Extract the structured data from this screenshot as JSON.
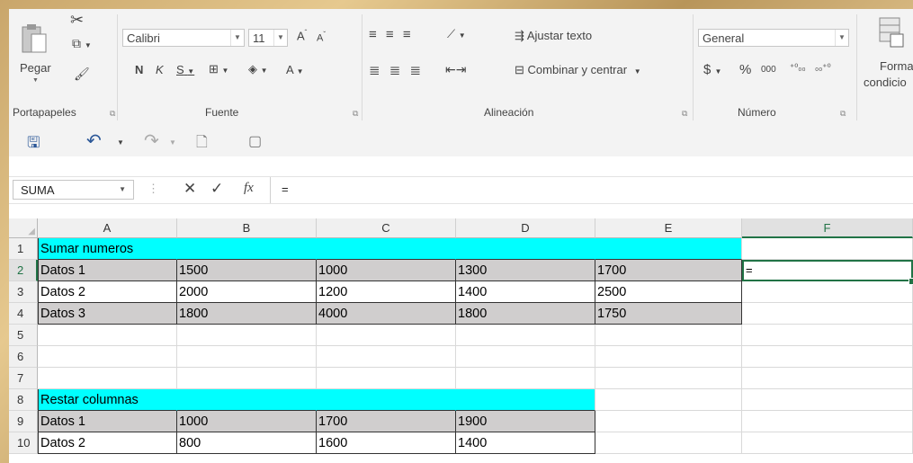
{
  "ribbon": {
    "clipboard": {
      "paste_label": "Pegar",
      "group_label": "Portapapeles"
    },
    "font": {
      "name": "Calibri",
      "size": "11",
      "bold": "N",
      "italic": "K",
      "underline": "S",
      "group_label": "Fuente",
      "grow": "A",
      "shrink": "A",
      "color": "A"
    },
    "alignment": {
      "wrap_label": "Ajustar texto",
      "merge_label": "Combinar y centrar",
      "group_label": "Alineación"
    },
    "number": {
      "format": "General",
      "currency": "$",
      "percent": "%",
      "thousands": "000",
      "inc_dec": "⁺⁰₀₀",
      "dec_dec": "₀₀⁺⁰",
      "group_label": "Número"
    },
    "styles": {
      "format_label_1": "Forma",
      "format_label_2": "condicio"
    }
  },
  "formula_bar": {
    "name_box": "SUMA",
    "fx": "fx",
    "content": "="
  },
  "columns": [
    "A",
    "B",
    "C",
    "D",
    "E",
    "F"
  ],
  "rows": [
    "1",
    "2",
    "3",
    "4",
    "5",
    "6",
    "7",
    "8",
    "9",
    "10"
  ],
  "cells": {
    "r1": [
      "Sumar numeros",
      "",
      "",
      "",
      "",
      ""
    ],
    "r2": [
      "Datos 1",
      "1500",
      "1000",
      "1300",
      "1700",
      "="
    ],
    "r3": [
      "Datos 2",
      "2000",
      "1200",
      "1400",
      "2500",
      ""
    ],
    "r4": [
      "Datos 3",
      "1800",
      "4000",
      "1800",
      "1750",
      ""
    ],
    "r5": [
      "",
      "",
      "",
      "",
      "",
      ""
    ],
    "r6": [
      "",
      "",
      "",
      "",
      "",
      ""
    ],
    "r7": [
      "",
      "",
      "",
      "",
      "",
      ""
    ],
    "r8": [
      "Restar columnas",
      "",
      "",
      "",
      "",
      ""
    ],
    "r9": [
      "Datos 1",
      "1000",
      "1700",
      "1900",
      "",
      ""
    ],
    "r10": [
      "Datos 2",
      "800",
      "1600",
      "1400",
      "",
      ""
    ]
  },
  "colors": {
    "cyan": "#00ffff",
    "gray": "#d0cece",
    "selection": "#217346"
  }
}
